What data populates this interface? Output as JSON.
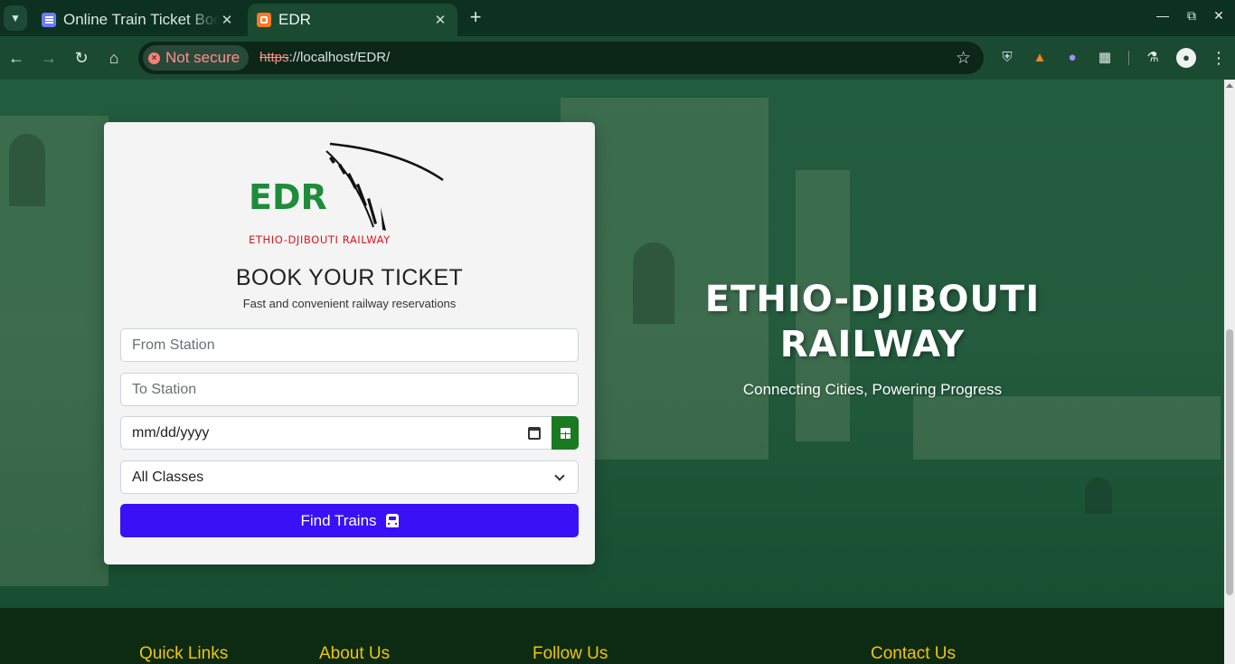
{
  "browser": {
    "tabs": [
      {
        "title": "Online Train Ticket Booking",
        "active": false
      },
      {
        "title": "EDR",
        "active": true
      }
    ],
    "new_tab_icon": "plus-icon",
    "security_label": "Not secure",
    "url_scheme": "https",
    "url_rest": "://localhost/EDR/"
  },
  "booking": {
    "logo_text": "EDR",
    "logo_caption": "ETHIO-DJIBOUTI RAILWAY",
    "title": "BOOK YOUR TICKET",
    "subtitle": "Fast and convenient railway reservations",
    "from_placeholder": "From Station",
    "to_placeholder": "To Station",
    "date_value": "mm/dd/yyyy",
    "class_selected": "All Classes",
    "submit_label": "Find Trains"
  },
  "hero": {
    "title": "ETHIO-DJIBOUTI RAILWAY",
    "subtitle": "Connecting Cities, Powering Progress"
  },
  "footer": {
    "headings": [
      "Quick Links",
      "About Us",
      "Follow Us",
      "Contact Us"
    ]
  },
  "colors": {
    "brand_green": "#1e8c3a",
    "brand_red": "#e0141e",
    "submit_blue": "#3811f6",
    "footer_heading": "#f1c40f"
  }
}
